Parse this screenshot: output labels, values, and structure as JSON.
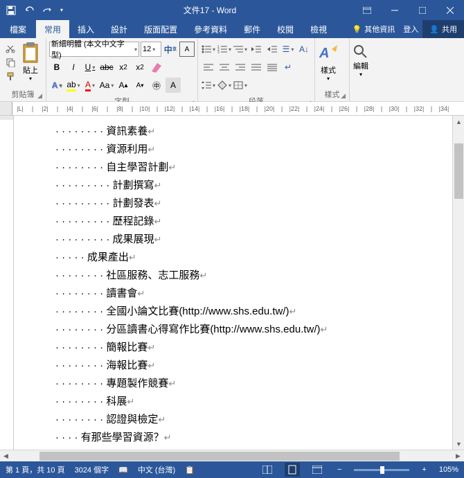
{
  "titlebar": {
    "title": "文件17 - Word"
  },
  "tabs": {
    "file": "檔案",
    "home": "常用",
    "insert": "插入",
    "design": "設計",
    "layout": "版面配置",
    "references": "參考資料",
    "mailings": "郵件",
    "review": "校閱",
    "view": "檢視",
    "tell_me": "其他資訊",
    "signin": "登入",
    "share": "共用"
  },
  "ribbon": {
    "clipboard": {
      "paste": "貼上",
      "label": "剪貼簿"
    },
    "font": {
      "name": "新細明體 (本文中文字型)",
      "size": "12",
      "label": "字型"
    },
    "paragraph": {
      "label": "段落"
    },
    "styles": {
      "btn": "樣式",
      "label": "樣式"
    },
    "editing": {
      "btn": "編輯"
    }
  },
  "ruler": [
    "L",
    "",
    "2",
    "",
    "4",
    "",
    "6",
    "",
    "8",
    "",
    "10",
    "",
    "12",
    "",
    "14",
    "",
    "16",
    "",
    "18",
    "",
    "20",
    "",
    "22",
    "",
    "24",
    "",
    "26",
    "",
    "28",
    "",
    "30",
    "",
    "32",
    "",
    "34"
  ],
  "document": {
    "lines": [
      {
        "indent": 8,
        "text": "資訊素養"
      },
      {
        "indent": 8,
        "text": "資源利用"
      },
      {
        "indent": 8,
        "text": "自主學習計劃"
      },
      {
        "indent": 9,
        "text": "計劃撰寫"
      },
      {
        "indent": 9,
        "text": "計劃發表"
      },
      {
        "indent": 9,
        "text": "歷程記錄"
      },
      {
        "indent": 9,
        "text": "成果展現"
      },
      {
        "indent": 5,
        "text": "成果產出"
      },
      {
        "indent": 8,
        "text": "社區服務、志工服務"
      },
      {
        "indent": 8,
        "text": "讀書會"
      },
      {
        "indent": 8,
        "text": "全國小論文比賽(http://www.shs.edu.tw/)"
      },
      {
        "indent": 8,
        "text": "分區讀書心得寫作比賽(http://www.shs.edu.tw/)"
      },
      {
        "indent": 8,
        "text": "簡報比賽"
      },
      {
        "indent": 8,
        "text": "海報比賽"
      },
      {
        "indent": 8,
        "text": "專題製作競賽"
      },
      {
        "indent": 8,
        "text": "科展"
      },
      {
        "indent": 8,
        "text": "認證與檢定"
      },
      {
        "indent": 4,
        "text": "有那些學習資源？"
      }
    ]
  },
  "statusbar": {
    "page": "第 1 頁，共 10 頁",
    "words": "3024 個字",
    "lang": "中文 (台灣)",
    "zoom": "105%"
  }
}
